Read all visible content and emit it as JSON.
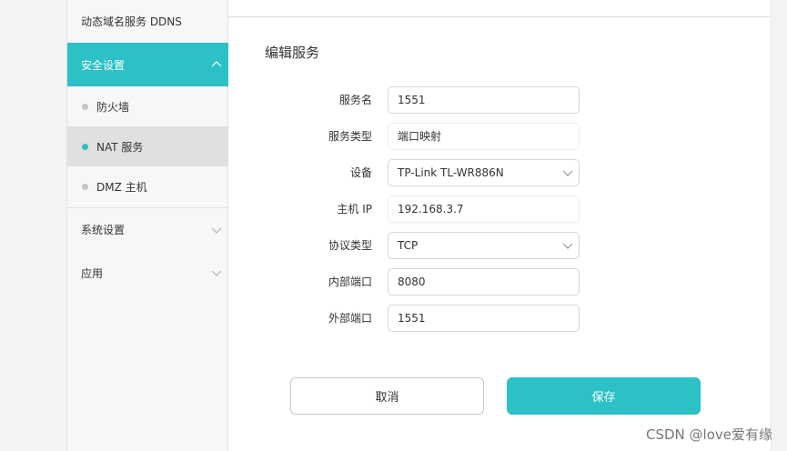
{
  "sidebar": {
    "ddns_label": "动态域名服务 DDNS",
    "security_label": "安全设置",
    "sub_items": [
      {
        "label": "防火墙"
      },
      {
        "label": "NAT 服务"
      },
      {
        "label": "DMZ 主机"
      }
    ],
    "system_label": "系统设置",
    "apps_label": "应用"
  },
  "form": {
    "title": "编辑服务",
    "service_name_label": "服务名",
    "service_name_value": "1551",
    "service_type_label": "服务类型",
    "service_type_value": "端口映射",
    "device_label": "设备",
    "device_value": "TP-Link TL-WR886N",
    "host_ip_label": "主机 IP",
    "host_ip_value": "192.168.3.7",
    "protocol_label": "协议类型",
    "protocol_value": "TCP",
    "internal_port_label": "内部端口",
    "internal_port_value": "8080",
    "external_port_label": "外部端口",
    "external_port_value": "1551"
  },
  "buttons": {
    "cancel": "取消",
    "save": "保存"
  },
  "watermark": "CSDN @love爱有缘",
  "colors": {
    "accent": "#2cc1c6"
  }
}
